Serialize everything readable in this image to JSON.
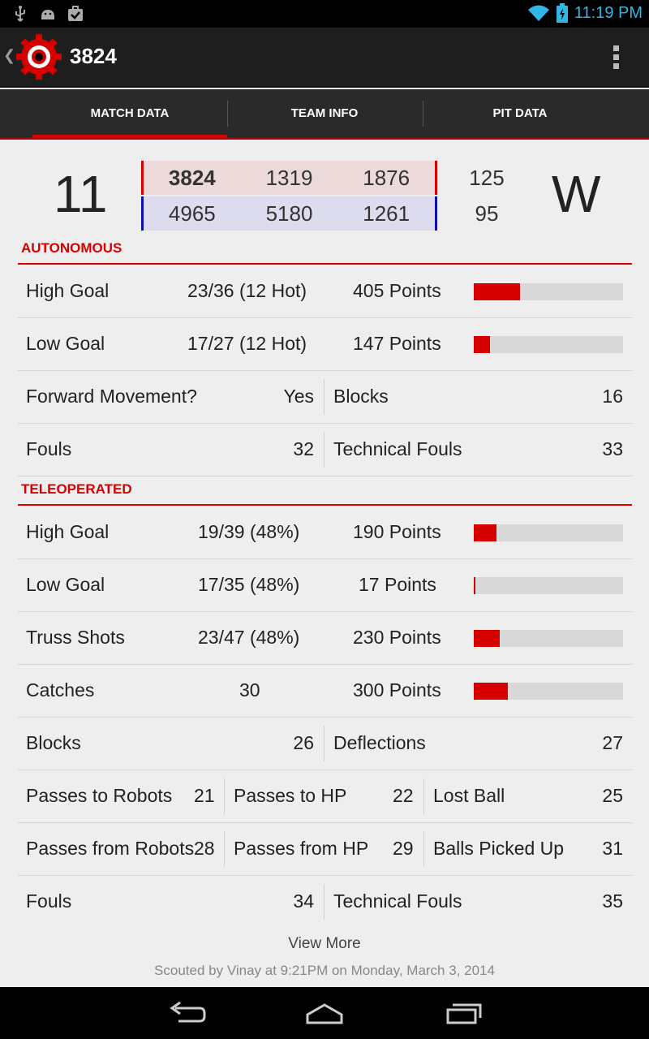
{
  "status_bar": {
    "time": "11:19 PM",
    "icons": [
      "usb-icon",
      "android-icon",
      "briefcase-check-icon",
      "wifi-icon",
      "battery-charging-icon"
    ]
  },
  "action_bar": {
    "title": "3824",
    "icons": [
      "back-chevron-icon",
      "team-logo-icon",
      "overflow-menu-icon"
    ]
  },
  "tabs": [
    {
      "label": "MATCH DATA",
      "active": true
    },
    {
      "label": "TEAM INFO",
      "active": false
    },
    {
      "label": "PIT DATA",
      "active": false
    }
  ],
  "match": {
    "number": "11",
    "red_alliance": [
      "3824",
      "1319",
      "1876"
    ],
    "blue_alliance": [
      "4965",
      "5180",
      "1261"
    ],
    "red_score": "125",
    "blue_score": "95",
    "result": "W"
  },
  "autonomous": {
    "header": "AUTONOMOUS",
    "high_goal": {
      "label": "High Goal",
      "value": "23/36 (12 Hot)",
      "points": "405 Points",
      "bar": 0.31
    },
    "low_goal": {
      "label": "Low Goal",
      "value": "17/27 (12 Hot)",
      "points": "147 Points",
      "bar": 0.11
    },
    "forward_movement": {
      "label": "Forward Movement?",
      "value": "Yes"
    },
    "blocks": {
      "label": "Blocks",
      "value": "16"
    },
    "fouls": {
      "label": "Fouls",
      "value": "32"
    },
    "technical_fouls": {
      "label": "Technical Fouls",
      "value": "33"
    }
  },
  "teleoperated": {
    "header": "TELEOPERATED",
    "high_goal": {
      "label": "High Goal",
      "value": "19/39 (48%)",
      "points": "190 Points",
      "bar": 0.15
    },
    "low_goal": {
      "label": "Low Goal",
      "value": "17/35 (48%)",
      "points": "17 Points",
      "bar": 0.012
    },
    "truss_shots": {
      "label": "Truss Shots",
      "value": "23/47 (48%)",
      "points": "230 Points",
      "bar": 0.175
    },
    "catches": {
      "label": "Catches",
      "value": "30",
      "points": "300 Points",
      "bar": 0.23
    },
    "blocks": {
      "label": "Blocks",
      "value": "26"
    },
    "deflections": {
      "label": "Deflections",
      "value": "27"
    },
    "passes_to_robots": {
      "label": "Passes to Robots",
      "value": "21"
    },
    "passes_to_hp": {
      "label": "Passes to HP",
      "value": "22"
    },
    "lost_ball": {
      "label": "Lost Ball",
      "value": "25"
    },
    "passes_from_robots": {
      "label": "Passes from Robots",
      "value": "28"
    },
    "passes_from_hp": {
      "label": "Passes from HP",
      "value": "29"
    },
    "balls_picked_up": {
      "label": "Balls Picked Up",
      "value": "31"
    },
    "fouls": {
      "label": "Fouls",
      "value": "34"
    },
    "technical_fouls": {
      "label": "Technical Fouls",
      "value": "35"
    }
  },
  "footer": {
    "view_more": "View More",
    "scouted_by": "Scouted by Vinay at 9:21PM on Monday, March 3, 2014"
  },
  "nav_bar": {
    "icons": [
      "back-nav-icon",
      "home-nav-icon",
      "recents-nav-icon"
    ]
  },
  "colors": {
    "accent_red": "#d70000",
    "alliance_blue": "#1010b0",
    "holo_blue": "#33b5e5"
  }
}
